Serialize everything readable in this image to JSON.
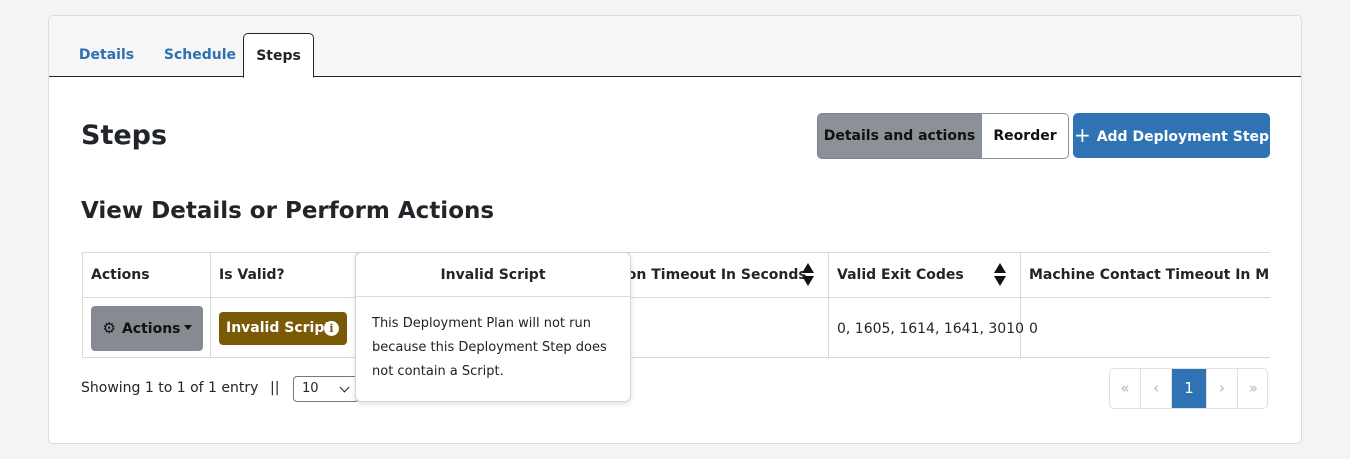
{
  "tabs": [
    {
      "label": "Details"
    },
    {
      "label": "Schedule"
    },
    {
      "label": "Steps"
    }
  ],
  "page_title": "Steps",
  "view_toggle": {
    "details_label": "Details and actions",
    "reorder_label": "Reorder"
  },
  "add_button_label": "Add Deployment Step",
  "section_title": "View Details or Perform Actions",
  "table": {
    "headers": [
      "Actions",
      "Is Valid?",
      "ion Timeout In Seconds",
      "Valid Exit Codes",
      "Machine Contact Timeout In Minute"
    ],
    "row": {
      "actions_label": "Actions",
      "is_valid": "Invalid Script",
      "valid_exit_codes": "0, 1605, 1614, 1641, 3010",
      "machine_contact_timeout": "0"
    }
  },
  "popover": {
    "title": "Invalid Script",
    "body": "This Deployment Plan will not run because this Deployment Step does not contain a Script."
  },
  "footer": {
    "showing": "Showing 1 to 1 of 1 entry",
    "separator": "||",
    "page_size": "10"
  },
  "pagination": {
    "first": "«",
    "prev": "‹",
    "current": "1",
    "next": "›",
    "last": "»"
  },
  "colors": {
    "primary": "#2f73b5",
    "badge": "#7a5a06",
    "toggle_active": "#8b9196"
  },
  "icons": {
    "add": "plus-icon",
    "actions": "gear-icon",
    "info": "info-icon"
  }
}
